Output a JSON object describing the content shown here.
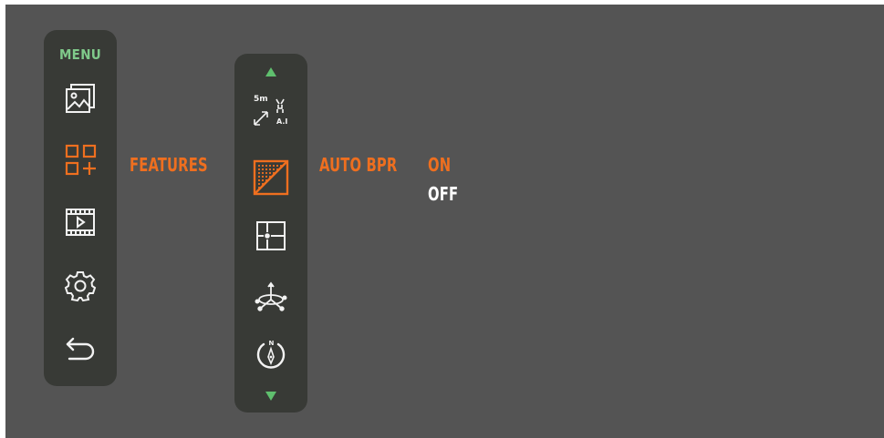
{
  "menu": {
    "title": "MENU",
    "items": [
      {
        "icon": "gallery-icon"
      },
      {
        "icon": "features-icon",
        "active": true
      },
      {
        "icon": "video-icon"
      },
      {
        "icon": "settings-gear-icon"
      },
      {
        "icon": "back-arrow-icon"
      }
    ]
  },
  "features_label": "FEATURES",
  "features": {
    "items": [
      {
        "icon": "auto-distance-ai-icon",
        "badge_top": "5m",
        "badge_bottom": "A.I"
      },
      {
        "icon": "auto-bpr-icon",
        "active": true
      },
      {
        "icon": "reticle-icon"
      },
      {
        "icon": "gyroscope-icon"
      },
      {
        "icon": "compass-icon",
        "letter": "N"
      }
    ]
  },
  "submenu_label": "AUTO BPR",
  "options": {
    "on": "ON",
    "off": "OFF",
    "selected": "ON"
  },
  "colors": {
    "accent": "#ef6f1f",
    "menu_title": "#7fc98a",
    "arrows": "#5fbf6e",
    "panel": "#383a36",
    "screen": "#545454",
    "icon_white": "#f2f2f2"
  }
}
